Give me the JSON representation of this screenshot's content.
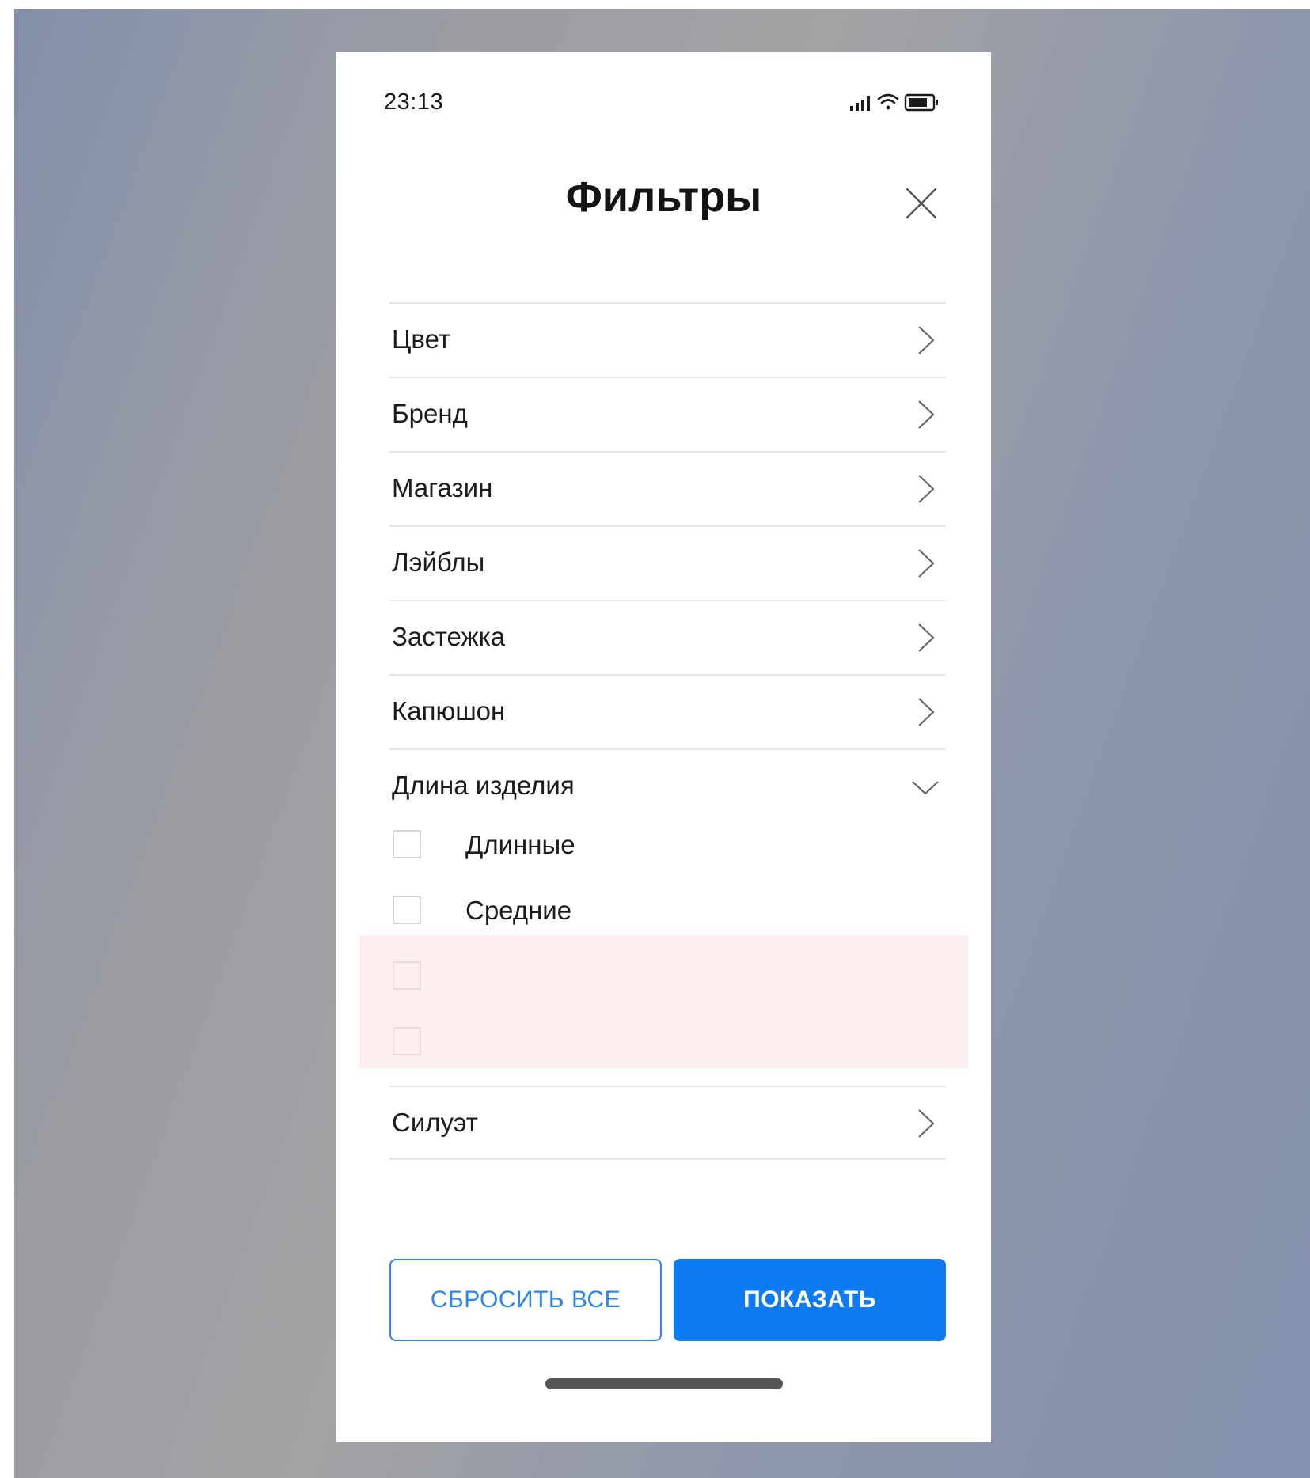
{
  "status_bar": {
    "time": "23:13"
  },
  "header": {
    "title": "Фильтры"
  },
  "filters": [
    {
      "label": "Цвет"
    },
    {
      "label": "Бренд"
    },
    {
      "label": "Магазин"
    },
    {
      "label": "Лэйблы"
    },
    {
      "label": "Застежка"
    },
    {
      "label": "Капюшон"
    }
  ],
  "expanded_filter": {
    "label": "Длина изделия",
    "options": [
      {
        "label": "Длинные",
        "checked": false
      },
      {
        "label": "Средние",
        "checked": false
      },
      {
        "label": "",
        "checked": false
      },
      {
        "label": "",
        "checked": false
      }
    ]
  },
  "last_filter": {
    "label": "Силуэт"
  },
  "buttons": {
    "reset_label": "СБРОСИТЬ ВСЕ",
    "show_label": "ПОКАЗАТЬ"
  },
  "colors": {
    "accent": "#0f7bf2",
    "highlight": "#fdeeee",
    "divider": "#e4e4e4"
  }
}
